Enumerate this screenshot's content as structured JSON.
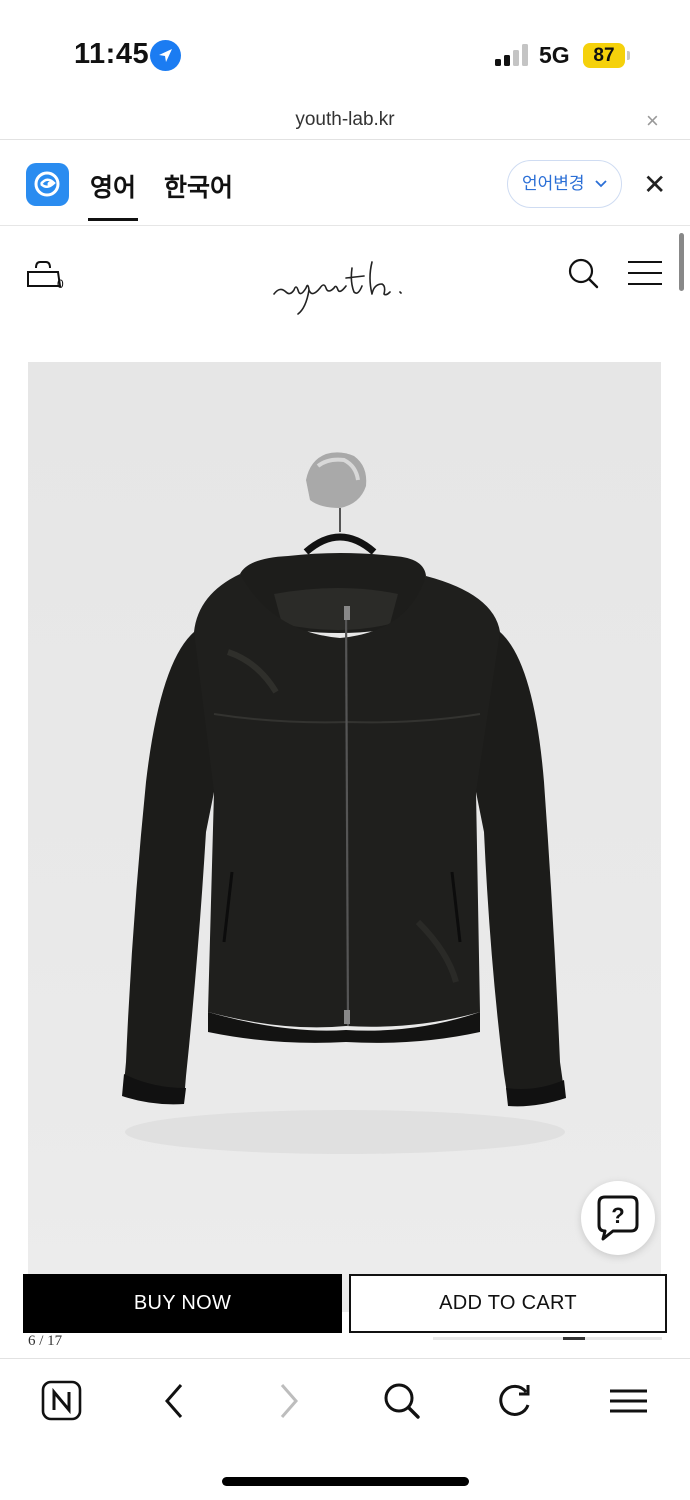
{
  "status_bar": {
    "time": "11:45",
    "network": "5G",
    "battery": "87"
  },
  "url_bar": {
    "domain": "youth-lab.kr",
    "close_label": "×"
  },
  "translate_bar": {
    "tab_english": "영어",
    "tab_korean": "한국어",
    "language_change": "언어변경",
    "close_label": "✕"
  },
  "header": {
    "cart_count": "0",
    "logo_text": "youth."
  },
  "product": {
    "image_counter": "6 / 17",
    "image_index": 6,
    "image_total": 17
  },
  "actions": {
    "buy_now": "BUY NOW",
    "add_to_cart": "ADD TO CART"
  },
  "help": {
    "label": "?"
  },
  "toolbar": {
    "home_icon": "naver-n-icon",
    "back_icon": "chevron-left-icon",
    "forward_icon": "chevron-right-icon",
    "search_icon": "search-icon",
    "reload_icon": "reload-icon",
    "menu_icon": "menu-icon"
  },
  "colors": {
    "accent_blue": "#2a8cf0",
    "battery_yellow": "#f5d10b",
    "button_black": "#000000"
  }
}
